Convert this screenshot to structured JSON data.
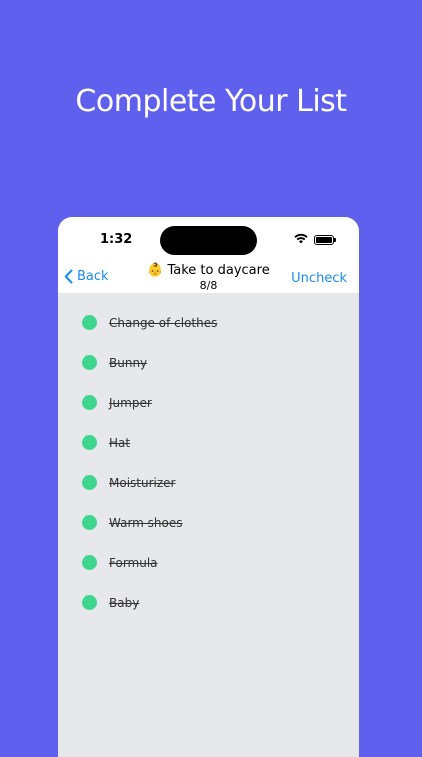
{
  "headline": "Complete Your List",
  "status": {
    "time": "1:32"
  },
  "nav": {
    "back_label": "Back",
    "title": "Take to daycare",
    "title_emoji": "👶",
    "count": "8/8",
    "uncheck_label": "Uncheck"
  },
  "items": [
    {
      "label": "Change of clothes",
      "checked": true
    },
    {
      "label": "Bunny",
      "checked": true
    },
    {
      "label": "Jumper",
      "checked": true
    },
    {
      "label": "Hat",
      "checked": true
    },
    {
      "label": "Moisturizer",
      "checked": true
    },
    {
      "label": "Warm shoes",
      "checked": true
    },
    {
      "label": "Formula",
      "checked": true
    },
    {
      "label": "Baby",
      "checked": true
    }
  ],
  "colors": {
    "background": "#6060EE",
    "accent": "#1A8CF0",
    "check": "#3DD68C",
    "list_bg": "#E7E8EB"
  }
}
